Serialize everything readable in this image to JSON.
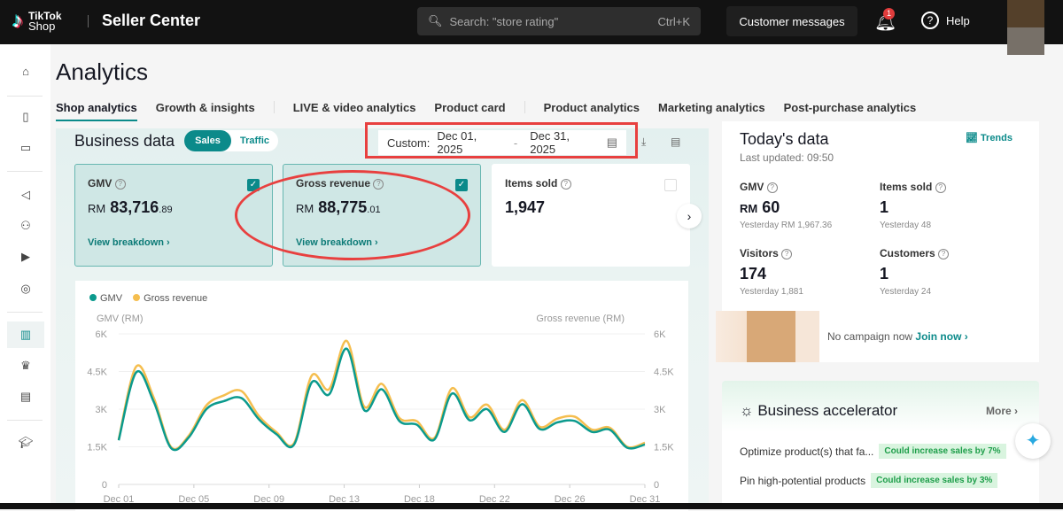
{
  "header": {
    "brand_top": "TikTok",
    "brand_bottom": "Shop",
    "title": "Seller Center",
    "search_placeholder": "Search: \"store rating\"",
    "shortcut": "Ctrl+K",
    "customer_messages": "Customer messages",
    "notification_count": "1",
    "help": "Help"
  },
  "page": {
    "title": "Analytics",
    "tabs": [
      "Shop analytics",
      "Growth & insights",
      "LIVE & video analytics",
      "Product card",
      "Product analytics",
      "Marketing analytics",
      "Post-purchase analytics"
    ],
    "active_tab": 0
  },
  "business": {
    "title": "Business data",
    "toggle": [
      "Sales",
      "Traffic"
    ],
    "date_label": "Custom:",
    "date_from": "Dec 01, 2025",
    "date_sep": "-",
    "date_to": "Dec 31, 2025",
    "cards": [
      {
        "label": "GMV",
        "currency": "RM",
        "value": "83,716",
        "decimals": ".89",
        "link": "View breakdown ›",
        "checked": true
      },
      {
        "label": "Gross revenue",
        "currency": "RM",
        "value": "88,775",
        "decimals": ".01",
        "link": "View breakdown ›",
        "checked": true
      },
      {
        "label": "Items sold",
        "value": "1,947",
        "checked": false
      }
    ]
  },
  "today": {
    "title": "Today's data",
    "updated": "Last updated: 09:50",
    "trends": "Trends",
    "stats": [
      {
        "label": "GMV",
        "currency": "RM",
        "value": "60",
        "yesterday": "Yesterday RM 1,967.36"
      },
      {
        "label": "Items sold",
        "value": "1",
        "yesterday": "Yesterday 48"
      },
      {
        "label": "Visitors",
        "value": "174",
        "yesterday": "Yesterday 1,881"
      },
      {
        "label": "Customers",
        "value": "1",
        "yesterday": "Yesterday 24"
      }
    ]
  },
  "campaign": {
    "text": "No campaign now",
    "link": "Join now ›"
  },
  "accelerator": {
    "title": "Business accelerator",
    "more": "More ›",
    "items": [
      {
        "text": "Optimize product(s) that fa...",
        "tag": "Could increase sales by 7%"
      },
      {
        "text": "Pin high-potential products",
        "tag": "Could increase sales by 3%"
      }
    ]
  },
  "colors": {
    "gmv": "#0b9a8d",
    "gross": "#f5be4f",
    "accent": "#0b8a8a"
  },
  "chart_data": {
    "type": "line",
    "ylabel_left": "GMV (RM)",
    "ylabel_right": "Gross revenue (RM)",
    "ylim": [
      0,
      6000
    ],
    "yticks": [
      "0",
      "1.5K",
      "3K",
      "4.5K",
      "6K"
    ],
    "xtick_labels": [
      "Dec 01",
      "Dec 05",
      "Dec 09",
      "Dec 13",
      "Dec 18",
      "Dec 22",
      "Dec 26",
      "Dec 31"
    ],
    "series": [
      {
        "name": "GMV",
        "values": [
          1760,
          4470,
          3290,
          1440,
          1880,
          3000,
          3320,
          3440,
          2590,
          2000,
          1590,
          4060,
          3590,
          5410,
          2960,
          3790,
          2530,
          2380,
          1790,
          3620,
          2560,
          3000,
          2090,
          3200,
          2210,
          2470,
          2530,
          2090,
          2180,
          1460,
          1590
        ]
      },
      {
        "name": "Gross revenue",
        "values": [
          1800,
          4700,
          3450,
          1480,
          1950,
          3150,
          3550,
          3720,
          2720,
          2080,
          1650,
          4330,
          3800,
          5720,
          3100,
          4010,
          2650,
          2520,
          1850,
          3830,
          2680,
          3180,
          2180,
          3360,
          2300,
          2620,
          2700,
          2180,
          2260,
          1500,
          1660
        ]
      }
    ]
  }
}
